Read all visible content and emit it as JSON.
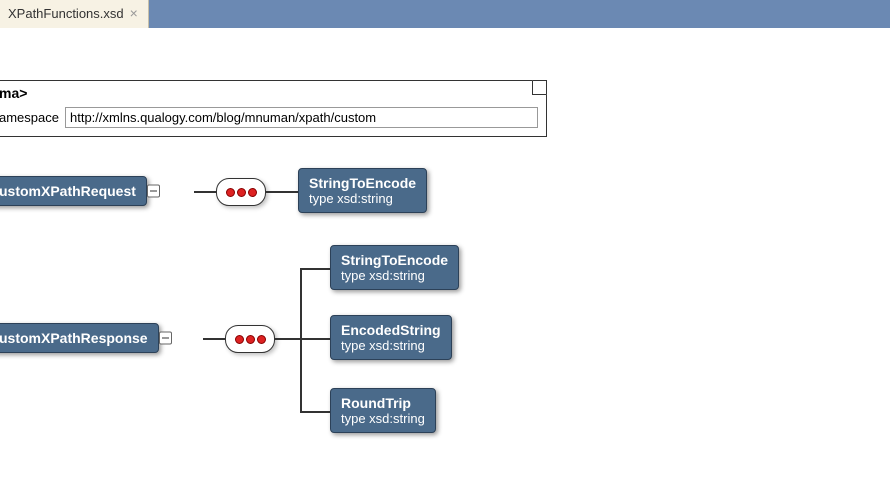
{
  "tab": {
    "label": "XPathFunctions.xsd"
  },
  "schema": {
    "title": "ma>",
    "ns_label": "amespace",
    "ns_value": "http://xmlns.qualogy.com/blog/mnuman/xpath/custom"
  },
  "request": {
    "name": "ustomXPathRequest",
    "fields": [
      {
        "name": "StringToEncode",
        "type": "type xsd:string"
      }
    ]
  },
  "response": {
    "name": "ustomXPathResponse",
    "fields": [
      {
        "name": "StringToEncode",
        "type": "type xsd:string"
      },
      {
        "name": "EncodedString",
        "type": "type xsd:string"
      },
      {
        "name": "RoundTrip",
        "type": "type xsd:string"
      }
    ]
  }
}
